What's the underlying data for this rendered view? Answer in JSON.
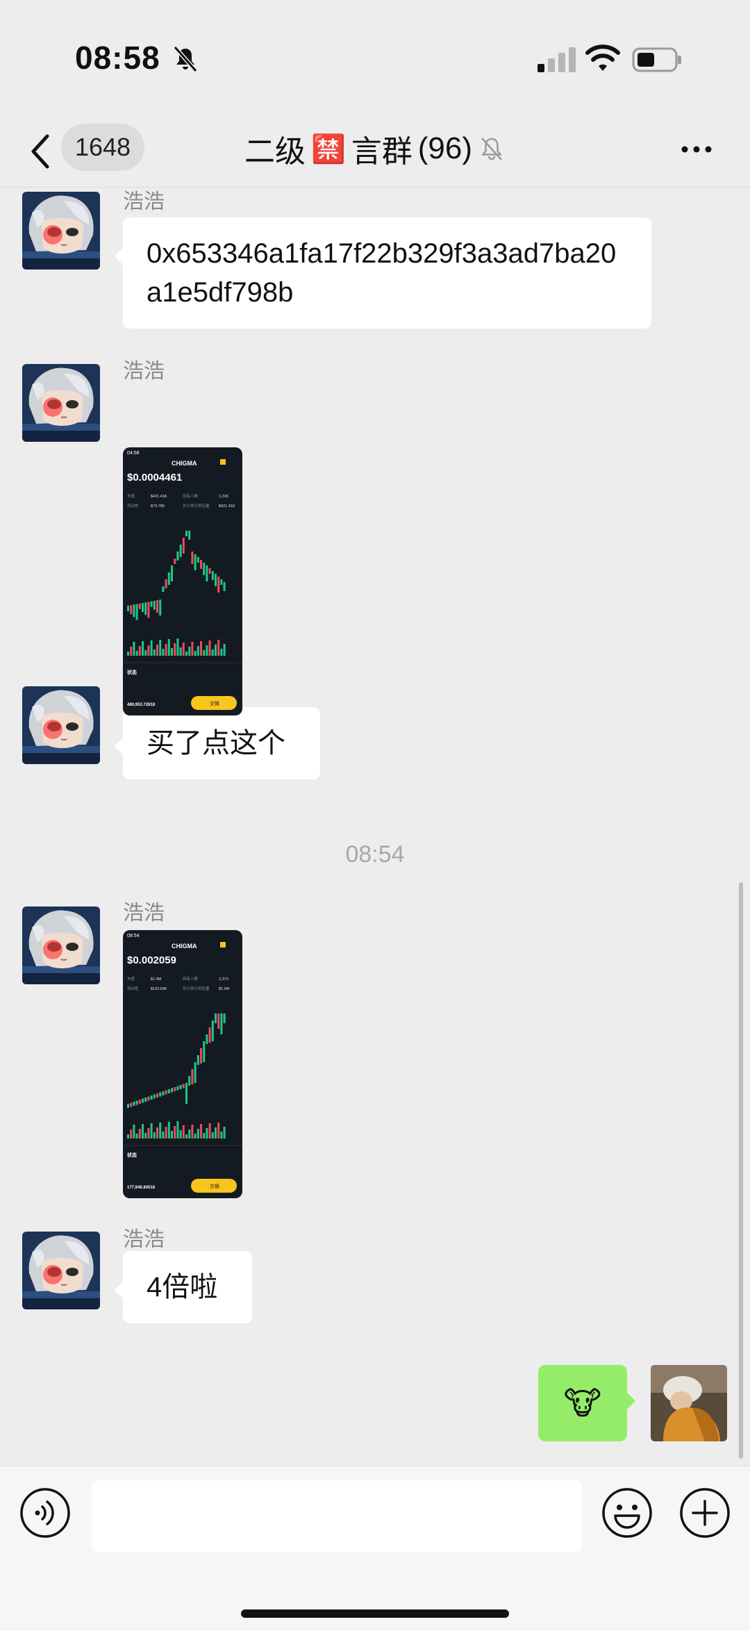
{
  "status_bar": {
    "time": "08:58",
    "icons": [
      "bell-slash-icon",
      "signal-icon",
      "wifi-icon",
      "battery-icon"
    ]
  },
  "nav": {
    "unread_count": "1648",
    "title_prefix": "二级",
    "title_emoji": "🈲",
    "title_suffix": "言群",
    "member_count": "(96)",
    "icons": [
      "chevron-left-icon",
      "bell-slash-icon",
      "more-icon"
    ]
  },
  "messages": [
    {
      "type": "text",
      "sender": "浩浩",
      "text": "0x653346a1fa17f22b329f3a3ad7ba20a1e5df798b"
    },
    {
      "type": "image",
      "sender": "浩浩",
      "screenshot": {
        "time": "04:58",
        "token": "CHIGMA",
        "price": "$0.0004461",
        "stats": [
          [
            "市值",
            "$421.41K",
            "持有人数",
            "1,226"
          ],
          [
            "流动性",
            "$74.78K",
            "总计发行供应量",
            "$421.41K"
          ]
        ],
        "section": "状态",
        "volume_value": "480,953.72818",
        "button": "交换"
      }
    },
    {
      "type": "text",
      "sender": "浩浩",
      "text": "买了点这个"
    },
    {
      "type": "time",
      "text": "08:54"
    },
    {
      "type": "image",
      "sender": "浩浩",
      "screenshot": {
        "time": "08:54",
        "token": "CHIGMA",
        "price": "$0.002059",
        "stats": [
          [
            "市值",
            "$1.9M",
            "持有人数",
            "2,373"
          ],
          [
            "流动性",
            "$163.83K",
            "总计发行供应量",
            "$1.9M"
          ]
        ],
        "section": "状态",
        "volume_value": "177,946.80518",
        "button": "交换"
      }
    },
    {
      "type": "text",
      "sender": "浩浩",
      "text": "4倍啦"
    },
    {
      "type": "outgoing_emoji",
      "text": "🐮"
    }
  ],
  "colors": {
    "background": "#ededed",
    "incoming_bubble": "#ffffff",
    "outgoing_bubble": "#95ec69",
    "sender_name": "#8a8a8a",
    "screenshot_bg": "#141a22",
    "screenshot_button": "#f7c51b"
  },
  "input_bar": {
    "text_value": "",
    "icons": [
      "voice-icon",
      "emoji-icon",
      "plus-icon"
    ]
  }
}
